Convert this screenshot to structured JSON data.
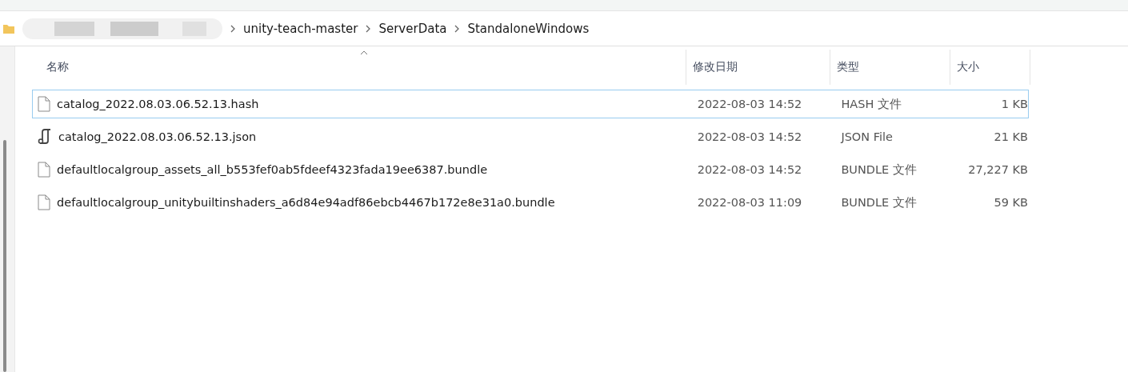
{
  "breadcrumb": [
    "unity-teach-master",
    "ServerData",
    "StandaloneWindows"
  ],
  "columns": [
    {
      "label": "名称",
      "sorted": true
    },
    {
      "label": "修改日期",
      "sorted": false
    },
    {
      "label": "类型",
      "sorted": false
    },
    {
      "label": "大小",
      "sorted": false
    }
  ],
  "rows": [
    {
      "kind": "file",
      "name": "catalog_2022.08.03.06.52.13.hash",
      "modified": "2022-08-03 14:52",
      "type": "HASH 文件",
      "size": "1 KB",
      "focused": true
    },
    {
      "kind": "script",
      "name": "catalog_2022.08.03.06.52.13.json",
      "modified": "2022-08-03 14:52",
      "type": "JSON File",
      "size": "21 KB",
      "focused": false
    },
    {
      "kind": "file",
      "name": "defaultlocalgroup_assets_all_b553fef0ab5fdeef4323fada19ee6387.bundle",
      "modified": "2022-08-03 14:52",
      "type": "BUNDLE 文件",
      "size": "27,227 KB",
      "focused": false
    },
    {
      "kind": "file",
      "name": "defaultlocalgroup_unitybuiltinshaders_a6d84e94adf86ebcb4467b172e8e31a0.bundle",
      "modified": "2022-08-03 11:09",
      "type": "BUNDLE 文件",
      "size": "59 KB",
      "focused": false
    }
  ]
}
